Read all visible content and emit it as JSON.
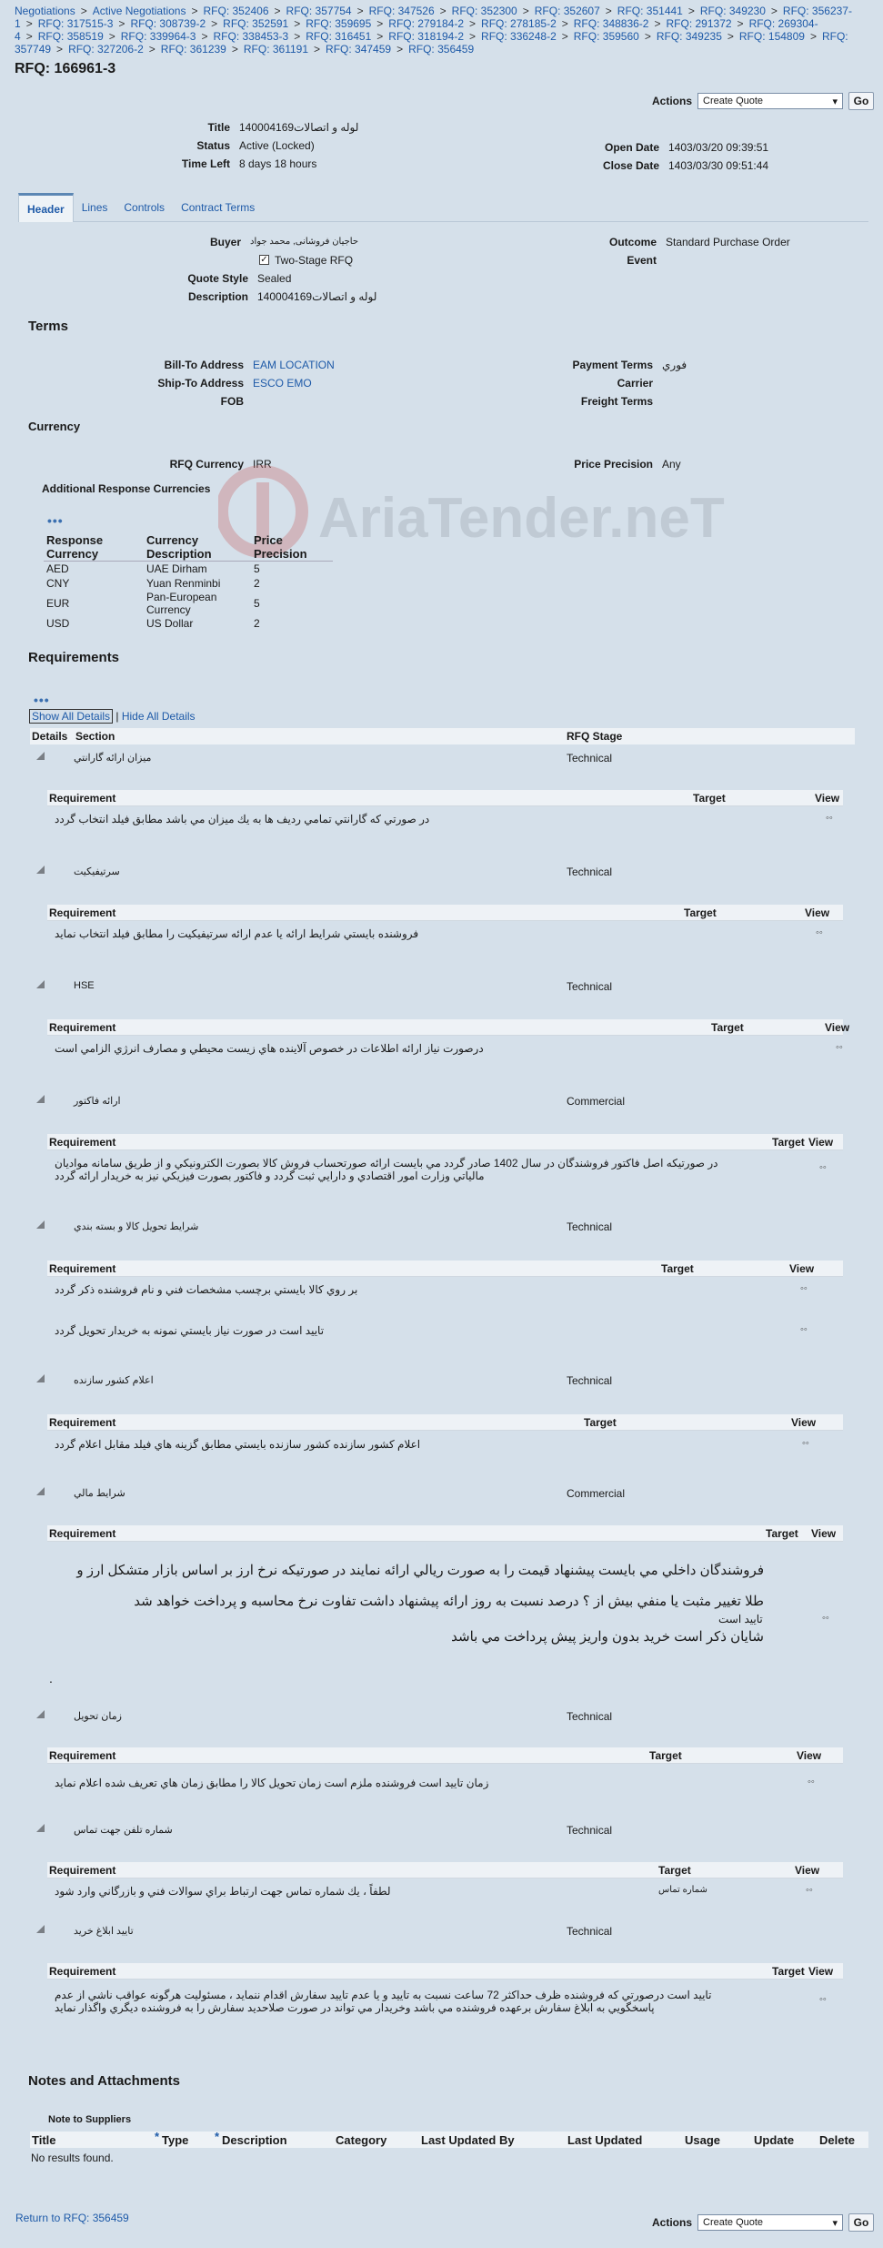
{
  "breadcrumbs": [
    "Negotiations",
    "Active Negotiations",
    "RFQ: 352406",
    "RFQ: 357754",
    "RFQ: 347526",
    "RFQ: 352300",
    "RFQ: 352607",
    "RFQ: 351441",
    "RFQ: 349230",
    "RFQ: 356237-1",
    "RFQ: 317515-3",
    "RFQ: 308739-2",
    "RFQ: 352591",
    "RFQ: 359695",
    "RFQ: 279184-2",
    "RFQ: 278185-2",
    "RFQ: 348836-2",
    "RFQ: 291372",
    "RFQ: 269304-4",
    "RFQ: 358519",
    "RFQ: 339964-3",
    "RFQ: 338453-3",
    "RFQ: 316451",
    "RFQ: 318194-2",
    "RFQ: 336248-2",
    "RFQ: 359560",
    "RFQ: 349235",
    "RFQ: 154809",
    "RFQ: 357749",
    "RFQ: 327206-2",
    "RFQ: 361239",
    "RFQ: 361191",
    "RFQ: 347459",
    "RFQ: 356459"
  ],
  "page_title": "RFQ: 166961-3",
  "actions": {
    "label": "Actions",
    "selected": "Create Quote",
    "go": "Go"
  },
  "summary": {
    "title_k": "Title",
    "title_v": "140004169لوله و اتصالات",
    "status_k": "Status",
    "status_v": "Active (Locked)",
    "time_k": "Time Left",
    "time_v": "8 days 18 hours",
    "open_k": "Open Date",
    "open_v": "1403/03/20 09:39:51",
    "close_k": "Close Date",
    "close_v": "1403/03/30 09:51:44"
  },
  "tabs": [
    "Header",
    "Lines",
    "Controls",
    "Contract Terms"
  ],
  "header": {
    "buyer_k": "Buyer",
    "buyer_v": "حاجیان فروشانی, محمد جواد",
    "two_stage": "Two-Stage RFQ",
    "quote_style_k": "Quote Style",
    "quote_style_v": "Sealed",
    "desc_k": "Description",
    "desc_v": "140004169لوله و اتصالات",
    "outcome_k": "Outcome",
    "outcome_v": "Standard Purchase Order",
    "event_k": "Event"
  },
  "terms": {
    "heading": "Terms",
    "bill_k": "Bill-To Address",
    "bill_v": "EAM LOCATION",
    "ship_k": "Ship-To Address",
    "ship_v": "ESCO EMO",
    "fob_k": "FOB",
    "pay_k": "Payment Terms",
    "pay_v": "فوري",
    "carrier_k": "Carrier",
    "freight_k": "Freight Terms"
  },
  "currency": {
    "heading": "Currency",
    "rfq_k": "RFQ Currency",
    "rfq_v": "IRR",
    "prec_k": "Price Precision",
    "prec_v": "Any",
    "additional": "Additional Response Currencies",
    "cols": [
      "Response Currency",
      "Currency Description",
      "Price Precision"
    ],
    "rows": [
      [
        "AED",
        "UAE Dirham",
        "5"
      ],
      [
        "CNY",
        "Yuan Renminbi",
        "2"
      ],
      [
        "EUR",
        "Pan-European Currency",
        "5"
      ],
      [
        "USD",
        "US Dollar",
        "2"
      ]
    ]
  },
  "watermark": "AriaTender.neT",
  "requirements": {
    "heading": "Requirements",
    "show_all": "Show All Details",
    "hide_all": "Hide All Details",
    "cols": [
      "Details",
      "Section",
      "RFQ Stage"
    ],
    "inner_cols": [
      "Requirement",
      "Target",
      "View"
    ],
    "sections": [
      {
        "name": "ميزان ارائه گارانتي",
        "stage": "Technical",
        "rows": [
          "در صورتي كه گارانتي تمامي رديف ها به يك ميزان مي باشد مطابق فيلد انتخاب گردد"
        ]
      },
      {
        "name": "سرتيفيكيت",
        "stage": "Technical",
        "rows": [
          "فروشنده بايستي شرايط ارائه يا عدم ارائه سرتيفيكيت را مطابق فيلد انتخاب نمايد"
        ]
      },
      {
        "name": "HSE",
        "stage": "Technical",
        "rows": [
          "درصورت نياز ارائه اطلاعات در خصوص آلاينده هاي زيست محيطي و مصارف انرژي الزامي است"
        ]
      },
      {
        "name": "ارائه فاكتور",
        "stage": "Commercial",
        "rows": [
          "در صورتيكه اصل فاكتور فروشندگان در سال 1402 صادر گردد مي بايست ارائه صورتحساب فروش كالا بصورت الكترونيكي و از طريق سامانه مواديان مالياتي وزارت امور اقتصادي و دارايي ثبت گردد و فاكتور بصورت فيزيكي نيز به خريدار ارائه گردد"
        ]
      },
      {
        "name": "شرايط تحويل كالا و بسته بندي",
        "stage": "Technical",
        "rows": [
          "بر روي كالا بايستي برچسب مشخصات فني و نام فروشنده ذكر گردد",
          "تاييد است  در صورت نياز بايستي نمونه به خريدار تحويل گردد"
        ]
      },
      {
        "name": "اعلام كشور سازنده",
        "stage": "Technical",
        "rows": [
          "اعلام كشور سازنده كشور سازنده بايستي مطابق گزينه هاي فيلد مقابل اعلام گردد"
        ]
      },
      {
        "name": "شرايط مالي",
        "stage": "Commercial",
        "rows": [
          "تایید است"
        ],
        "big": [
          "فروشندگان داخلي مي بايست پيشنهاد قيمت را به صورت ريالي ارائه نمايند در صورتيكه نرخ ارز بر اساس بازار متشكل ارز و",
          "طلا تغيير مثبت يا منفي بيش از ؟ درصد نسبت به روز ارائه پيشنهاد داشت تفاوت نرخ محاسبه و پرداخت خواهد شد",
          "شايان ذكر است خريد بدون واريز پيش پرداخت مي باشد"
        ],
        "dot": "."
      },
      {
        "name": "زمان تحويل",
        "stage": "Technical",
        "rows": [
          "زمان تاييد است  فروشنده ملزم است زمان تحويل كالا را مطابق زمان هاي تعريف شده اعلام نمايد"
        ]
      },
      {
        "name": "شماره تلفن جهت تماس",
        "stage": "Technical",
        "rows": [
          "لطفاً ، يك شماره تماس جهت ارتباط براي سوالات فني و بازرگاني وارد شود"
        ],
        "target": "شماره تماس"
      },
      {
        "name": "تاييد ابلاغ خريد",
        "stage": "Technical",
        "rows": [
          "تاييد است   درصورتي كه فروشنده ظرف حداكثر 72 ساعت نسبت به تاييد و يا عدم تاييد سفارش اقدام ننمايد ، مسئوليت هرگونه عواقب ناشي از عدم پاسخگويي به ابلاغ سفارش برعهده فروشنده مي باشد وخريدار مي تواند در صورت صلاحديد سفارش را به فروشنده ديگري واگذار نمايد"
        ]
      }
    ]
  },
  "notes": {
    "heading": "Notes and Attachments",
    "sub": "Note to Suppliers",
    "cols": [
      "Title",
      "Type",
      "Description",
      "Category",
      "Last Updated By",
      "Last Updated",
      "Usage",
      "Update",
      "Delete"
    ],
    "empty": "No results found."
  },
  "return_link": "Return to RFQ: 356459"
}
